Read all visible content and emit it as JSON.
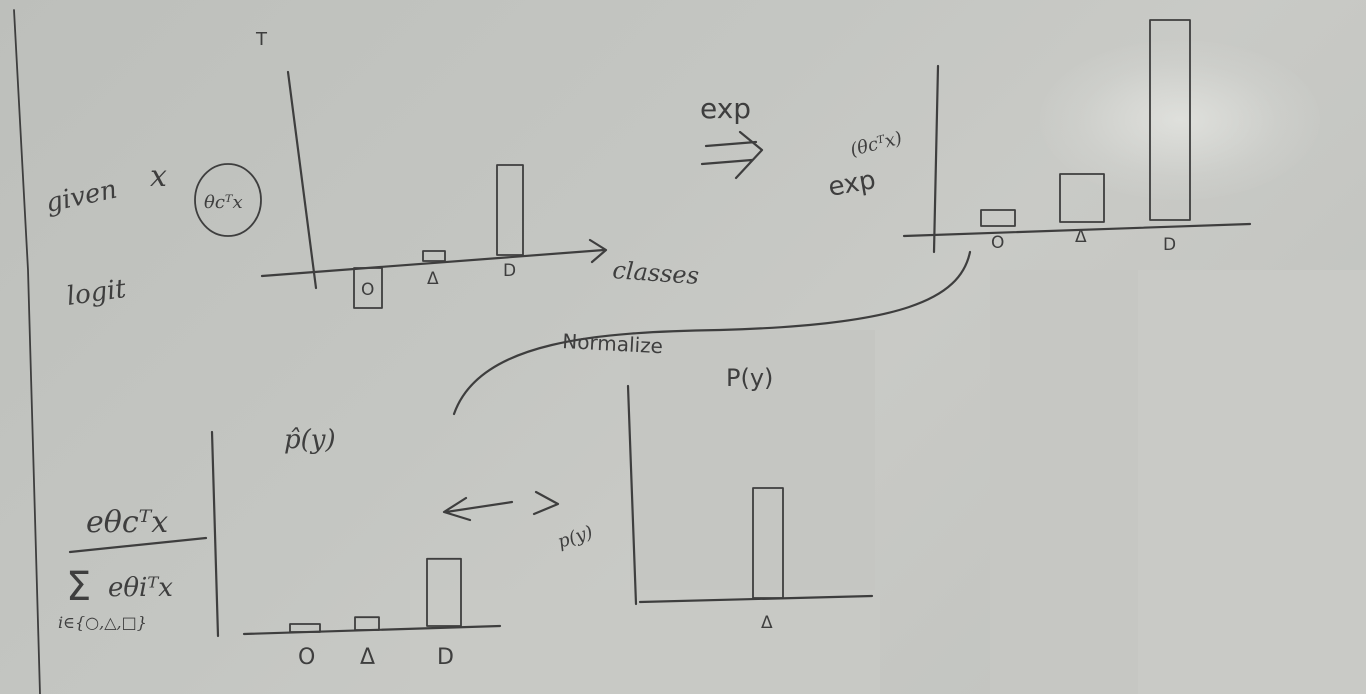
{
  "labels": {
    "given": "given",
    "x_var": "x",
    "theta_term": "θcᵀx",
    "logit": "logit",
    "classes": "classes",
    "exp": "exp",
    "exp_side_top": "(θcᵀx)",
    "exp_side": "exp",
    "normalize": "Normalize",
    "p_y_top": "P(y)",
    "p_hat_y": "p̂(y)",
    "p_y_side": "p(y)",
    "formula_numerator": "eθcᵀx",
    "formula_sum": "Σ",
    "formula_denominator": "eθiᵀx",
    "formula_index": "i∈{○,△,□}",
    "top_t": "T"
  },
  "classes": [
    "O",
    "Δ",
    "D"
  ],
  "charts": {
    "logit": {
      "values": [
        -0.4,
        0.1,
        0.9
      ]
    },
    "exp": {
      "values": [
        0.08,
        0.24,
        1.0
      ]
    },
    "phat": {
      "values": [
        0.05,
        0.08,
        0.42
      ]
    },
    "p": {
      "values": [
        0,
        1,
        0
      ]
    }
  },
  "colors": {
    "ink": "#3e3e3e",
    "board": "#c4c6c2"
  }
}
